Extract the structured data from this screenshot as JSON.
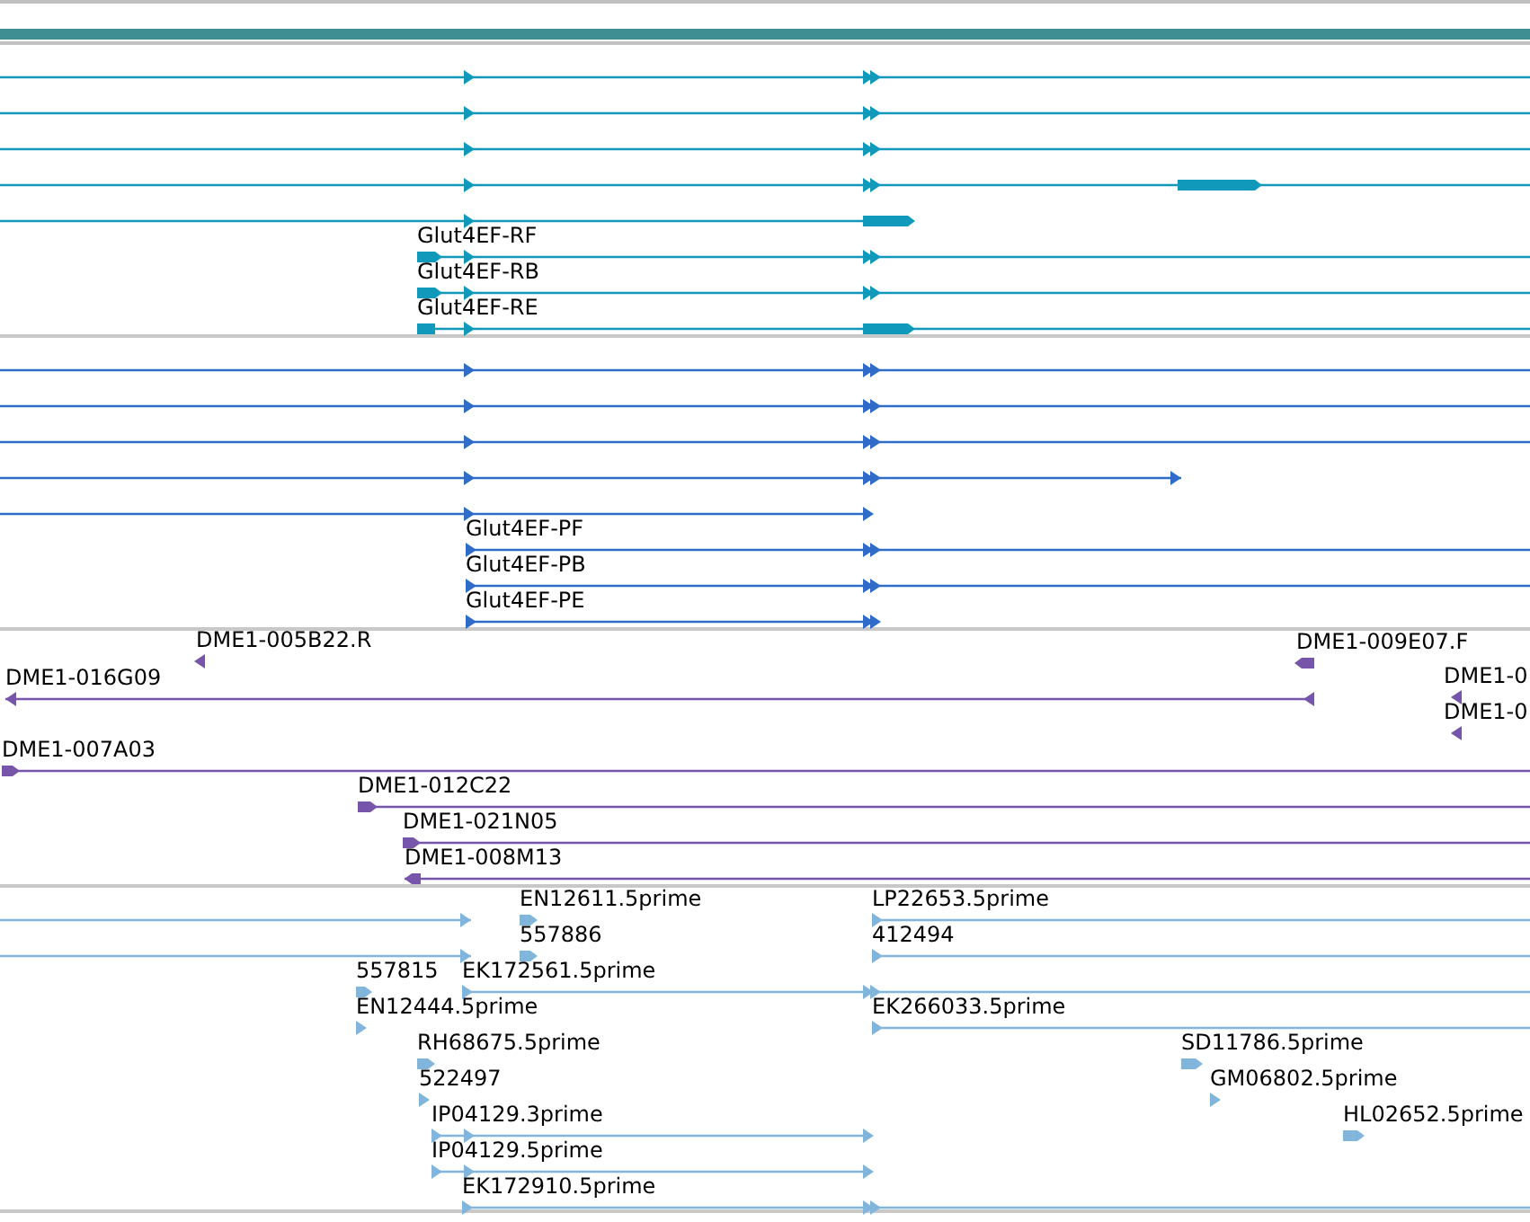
{
  "tracks": [
    {
      "color": "#1199bb",
      "features": [
        {
          "reverse": false
        },
        {
          "reverse": false
        },
        {
          "reverse": false
        },
        {
          "reverse": false
        },
        {
          "reverse": false
        },
        {
          "label": "Glut4EF-RF",
          "reverse": false
        },
        {
          "label": "Glut4EF-RB",
          "reverse": false
        },
        {
          "label": "Glut4EF-RE",
          "reverse": false
        }
      ]
    },
    {
      "color": "#2f6bc9",
      "features": [
        {
          "reverse": false
        },
        {
          "reverse": false
        },
        {
          "reverse": false
        },
        {
          "reverse": false
        },
        {
          "reverse": false
        },
        {
          "label": "Glut4EF-PF",
          "reverse": false
        },
        {
          "label": "Glut4EF-PB",
          "reverse": false
        },
        {
          "label": "Glut4EF-PE",
          "reverse": false
        }
      ]
    },
    {
      "color": "#7655aa",
      "features": [
        {
          "label": "DME1-005B22.R",
          "reverse": true
        },
        {
          "label": "DME1-009E07.F",
          "reverse": true
        },
        {
          "label": "DME1-016G09",
          "reverse": true
        },
        {
          "label": "DME1-0",
          "reverse": true
        },
        {
          "label": "DME1-0",
          "reverse": true
        },
        {
          "label": "DME1-007A03",
          "reverse": false
        },
        {
          "label": "DME1-012C22",
          "reverse": false
        },
        {
          "label": "DME1-021N05",
          "reverse": false
        },
        {
          "label": "DME1-008M13",
          "reverse": true
        }
      ]
    },
    {
      "color": "#82b5dc",
      "features": [
        {
          "reverse": false
        },
        {
          "reverse": false
        },
        {
          "label": "EN12611.5prime",
          "reverse": false
        },
        {
          "label": "557886",
          "reverse": false
        },
        {
          "label": "LP22653.5prime",
          "reverse": false
        },
        {
          "label": "412494",
          "reverse": false
        },
        {
          "label": "557815",
          "reverse": false
        },
        {
          "label": "EK172561.5prime",
          "reverse": false
        },
        {
          "label": "EN12444.5prime",
          "reverse": false
        },
        {
          "label": "EK266033.5prime",
          "reverse": false
        },
        {
          "label": "RH68675.5prime",
          "reverse": false
        },
        {
          "label": "SD11786.5prime",
          "reverse": false
        },
        {
          "label": "522497",
          "reverse": false
        },
        {
          "label": "GM06802.5prime",
          "reverse": false
        },
        {
          "label": "IP04129.3prime",
          "reverse": false
        },
        {
          "label": "HL02652.5prime",
          "reverse": false
        },
        {
          "label": "IP04129.5prime",
          "reverse": false
        },
        {
          "label": "EK172910.5prime",
          "reverse": false
        }
      ]
    }
  ]
}
